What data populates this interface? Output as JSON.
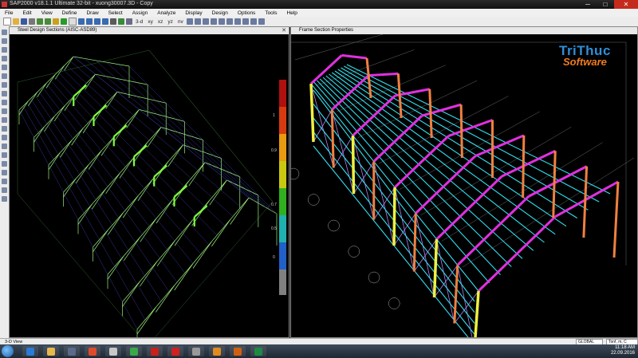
{
  "window": {
    "title": "SAP2000 v18.1.1 Ultimate 32-bit - xuong30007.3D - Copy",
    "buttons": [
      "─",
      "□",
      "✕"
    ]
  },
  "menu": [
    "File",
    "Edit",
    "View",
    "Define",
    "Draw",
    "Select",
    "Assign",
    "Analyze",
    "Display",
    "Design",
    "Options",
    "Tools",
    "Help"
  ],
  "toolbar": {
    "text_items": [
      "3-d",
      "xy",
      "xz",
      "yz",
      "nv"
    ]
  },
  "left_pane": {
    "title": "Steel Design Sections  (AISC-ASD89)",
    "scale_labels": [
      "1",
      "0.9",
      "0.7",
      "0.5",
      "0"
    ],
    "scale_colors": [
      "#b01010",
      "#d83a10",
      "#e89a10",
      "#c8c810",
      "#30b020",
      "#20b0b0",
      "#2060c8",
      "#808080"
    ]
  },
  "right_pane": {
    "title": "Frame Section Properties"
  },
  "logo": {
    "line1": "TriThuc",
    "line2": "Software"
  },
  "status": {
    "view": "3-D View",
    "coord_system": "GLOBAL",
    "units": "Tonf, m, C"
  },
  "taskbar": {
    "apps": [
      "ie-icon",
      "explorer-icon",
      "media-icon",
      "chrome-icon",
      "mail-icon",
      "chrome-icon-2",
      "autocad-icon",
      "acrobat-icon",
      "calculator-icon",
      "presentation-icon",
      "sap2000-icon",
      "excel-icon"
    ],
    "app_colors": [
      "#2a7bd8",
      "#e7b84a",
      "#5a6a8a",
      "#e04a2a",
      "#c8c8c8",
      "#3aa84a",
      "#c8201a",
      "#d02020",
      "#999999",
      "#e08a20",
      "#d06010",
      "#1e8a44"
    ],
    "time": "11:18 AM",
    "date": "22.09.2016"
  }
}
